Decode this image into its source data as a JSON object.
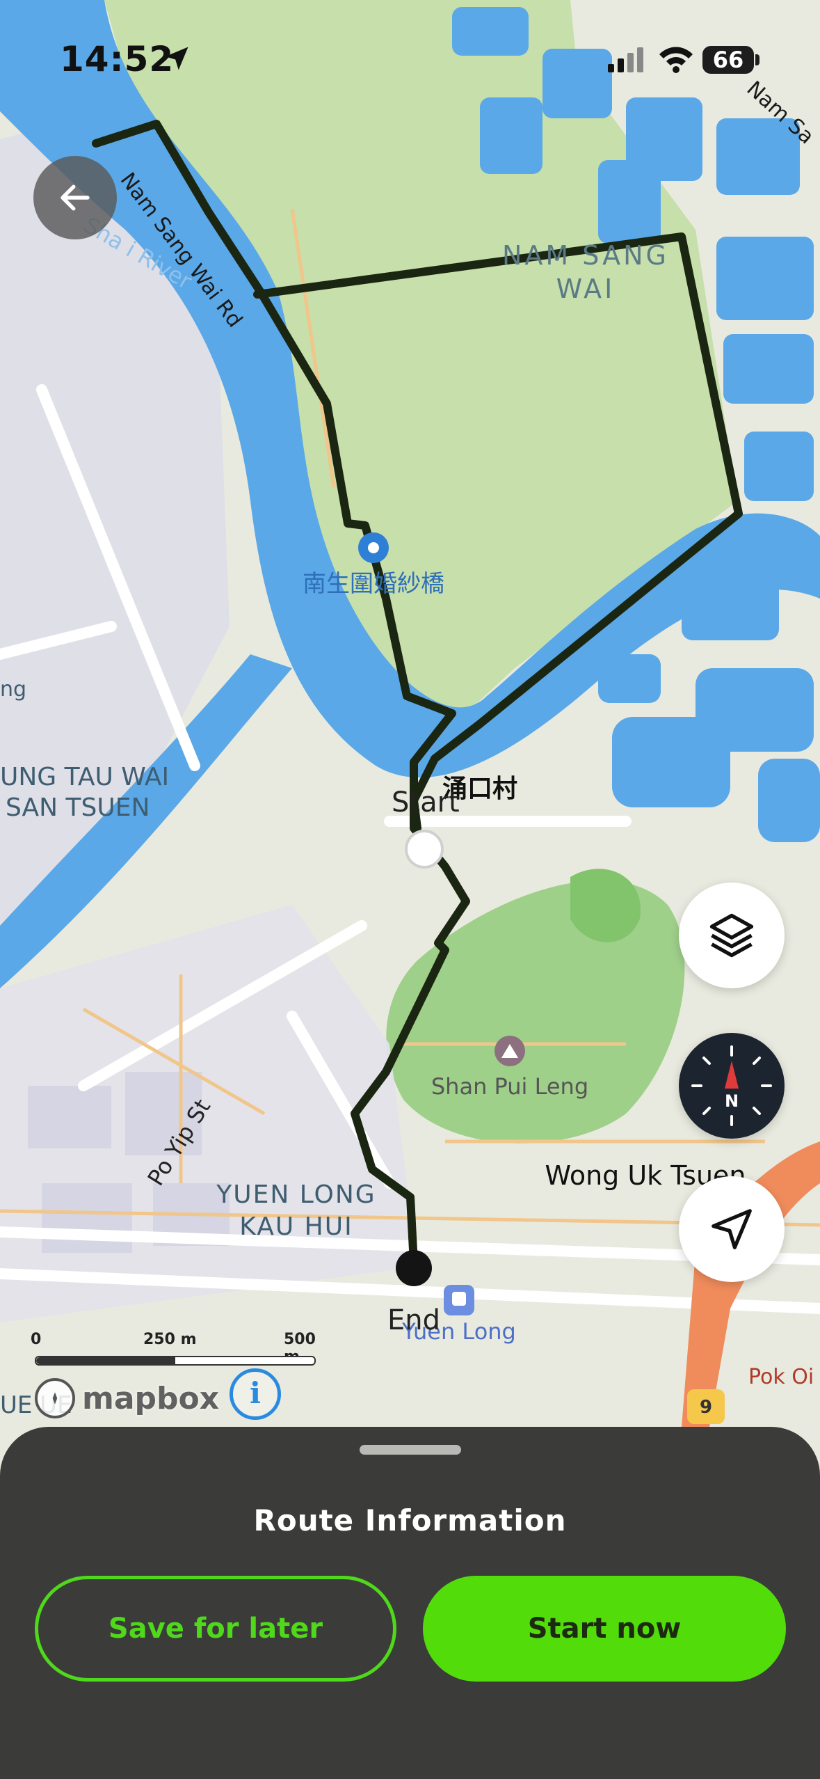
{
  "status_bar": {
    "time": "14:52",
    "battery": "66",
    "location_icon": "location-arrow-icon",
    "signal_icon": "cellular-signal-icon",
    "wifi_icon": "wifi-icon"
  },
  "map": {
    "labels": {
      "nam_sang_wai_line1": "NAM SANG",
      "nam_sang_wai_line2": "WAI",
      "nam_sang_wai_rd": "Nam Sang Wai Rd",
      "nam_sang_corner": "Nam Sa",
      "river_fragment": "Sha  i River",
      "bridge": "南生圍婚紗橋",
      "chung_kau_tsuen": "涌口村",
      "tung_tau_wai_line1": "UNG TAU WAI",
      "tung_tau_wai_line2": "SAN TSUEN",
      "left_edge": "ng",
      "shan_pui_leng": "Shan Pui Leng",
      "wong_uk_tsuen": "Wong Uk Tsuen",
      "po_yip_st": "Po Yip St",
      "yuen_long_kau_hui_line1": "YUEN LONG",
      "yuen_long_kau_hui_line2": "KAU HUI",
      "yuen_long_station": "Yuen Long",
      "pok_oi": "Pok Oi",
      "route_shield": "9",
      "bottom_left": "UE  UE"
    },
    "markers": {
      "start": "Start",
      "end": "End"
    },
    "colors": {
      "land": "#e9eadf",
      "park": "#c7dfab",
      "water": "#5aa8e8",
      "route": "#1b2612",
      "road_minor": "#f1c68a"
    }
  },
  "controls": {
    "back_icon": "back-arrow-icon",
    "layers_icon": "layers-icon",
    "compass_icon": "compass-icon",
    "compass_letter": "N",
    "locate_icon": "navigation-arrow-icon"
  },
  "scale_bar": {
    "label_0": "0",
    "label_250": "250 m",
    "label_500": "500 m"
  },
  "attribution": {
    "logo": "mapbox",
    "info": "i"
  },
  "sheet": {
    "title": "Route Information",
    "save_label": "Save for later",
    "start_label": "Start now",
    "accent": "#52dd0b"
  }
}
